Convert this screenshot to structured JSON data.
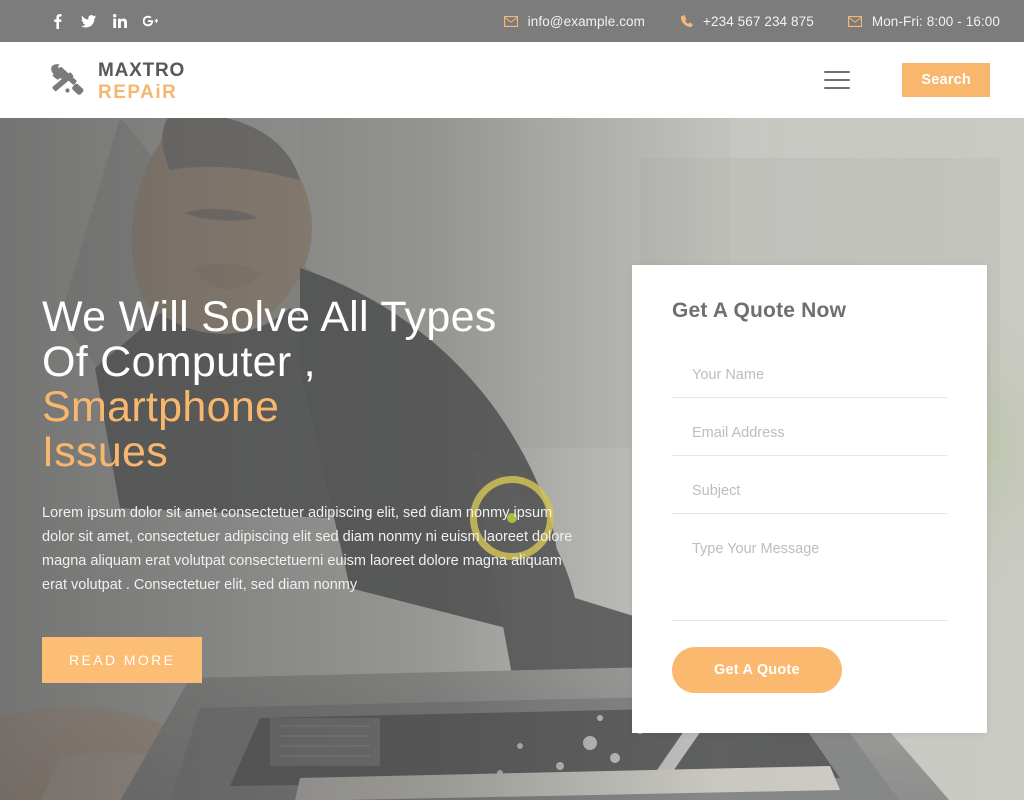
{
  "topbar": {
    "social": [
      {
        "name": "facebook",
        "label": "f"
      },
      {
        "name": "twitter",
        "label": "t"
      },
      {
        "name": "linkedin",
        "label": "in"
      },
      {
        "name": "googleplus",
        "label": "G+"
      }
    ],
    "contacts": [
      {
        "icon": "envelope-icon",
        "text": "info@example.com"
      },
      {
        "icon": "phone-icon",
        "text": "+234 567 234 875"
      },
      {
        "icon": "envelope-icon",
        "text": "Mon-Fri: 8:00 - 16:00"
      }
    ]
  },
  "header": {
    "logo_top": "MAXTRO",
    "logo_bottom": "REPAiR",
    "search_label": "Search",
    "menu_icon": "hamburger-menu-icon"
  },
  "hero": {
    "title_line1": "We Will Solve All Types",
    "title_line2": "Of Computer ,",
    "title_accent1": "Smartphone",
    "title_accent2": "Issues",
    "paragraph": "Lorem ipsum dolor sit amet consectetuer adipiscing elit, sed diam nonmy ipsum dolor sit amet, consectetuer adipiscing elit sed diam nonmy ni euism laoreet dolore magna aliquam erat volutpat consectetuerni euism laoreet dolore magna aliquam erat volutpat . Consectetuer elit, sed diam nonmy",
    "read_more": "READ MORE"
  },
  "quote_form": {
    "title": "Get A Quote Now",
    "name_placeholder": "Your Name",
    "email_placeholder": "Email Address",
    "subject_placeholder": "Subject",
    "message_placeholder": "Type Your Message",
    "submit_label": "Get A Quote"
  },
  "colors": {
    "accent_orange": "#f9b76e",
    "topbar_gray": "#7c7c7c",
    "logo_gray": "#585858",
    "ring_yellow": "#cfc157",
    "ring_dot_green": "#b9cf3f"
  }
}
